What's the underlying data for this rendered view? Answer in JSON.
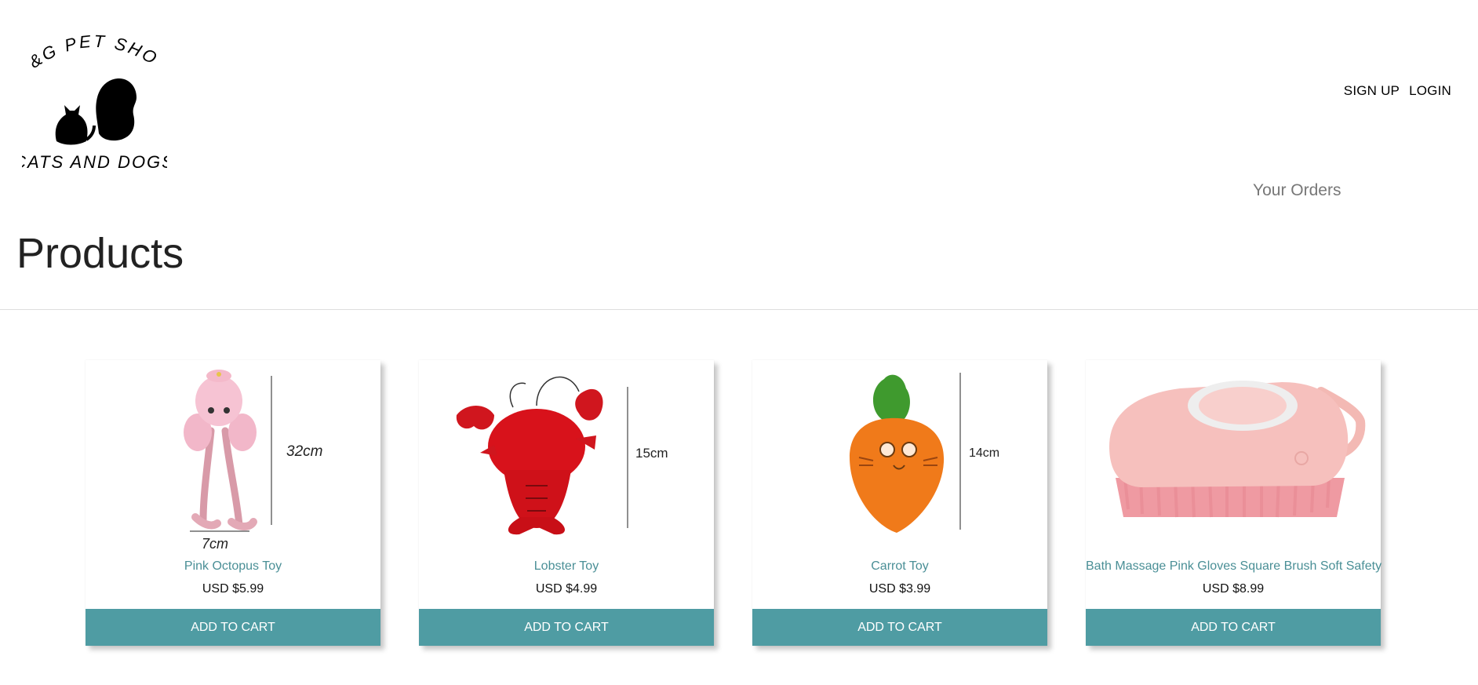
{
  "header": {
    "logo": {
      "top_text": "S&G PET SHOP",
      "bottom_text": "CATS AND DOGS"
    },
    "nav": {
      "signup": "SIGN UP",
      "login": "LOGIN"
    },
    "orders_link": "Your Orders"
  },
  "page": {
    "title": "Products"
  },
  "products": [
    {
      "name": "Pink Octopus Toy",
      "price": "USD $5.99",
      "button": "ADD TO CART",
      "dim_height": "32cm",
      "dim_width": "7cm"
    },
    {
      "name": "Lobster Toy",
      "price": "USD $4.99",
      "button": "ADD TO CART",
      "dim_height": "15cm"
    },
    {
      "name": "Carrot Toy",
      "price": "USD $3.99",
      "button": "ADD TO CART",
      "dim_height": "14cm"
    },
    {
      "name": "Bath Massage Pink Gloves Square Brush Soft Safety",
      "price": "USD $8.99",
      "button": "ADD TO CART"
    }
  ],
  "colors": {
    "accent": "#4f9ca3",
    "product_name": "#4a8f96",
    "orders_link": "#777777"
  }
}
